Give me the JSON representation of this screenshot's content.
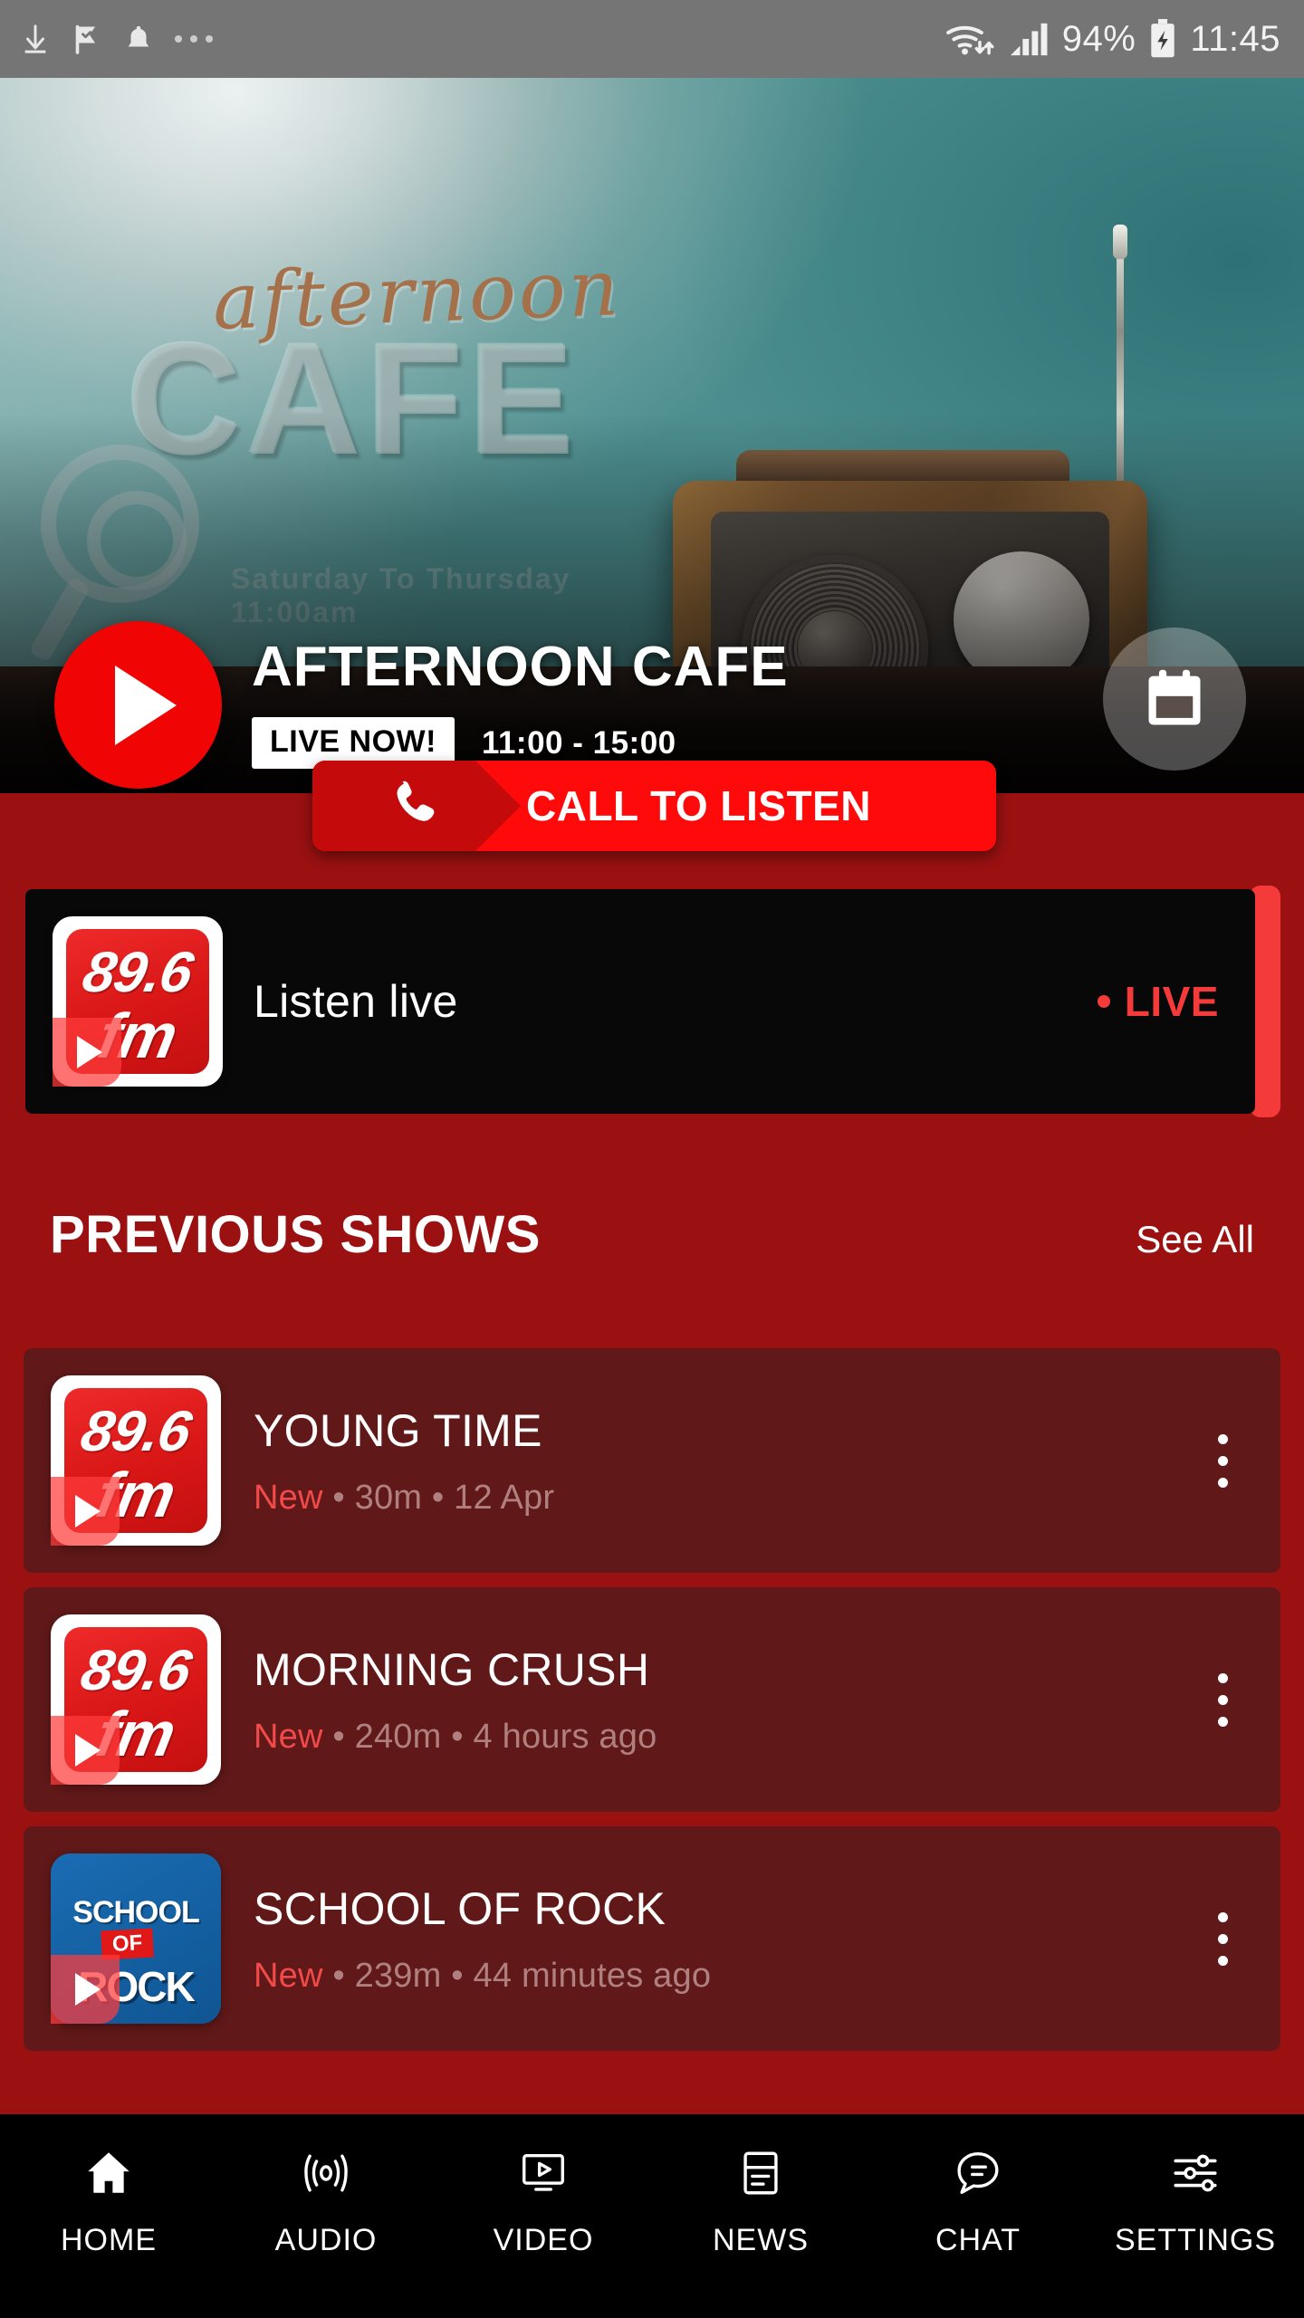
{
  "status_bar": {
    "icons_left": [
      "download-icon",
      "flag-check-icon",
      "bell-icon",
      "more-icon"
    ],
    "wifi": "wifi-icon",
    "signal": "signal-icon",
    "battery_percent": "94%",
    "battery": "battery-charging-icon",
    "time": "11:45"
  },
  "hero": {
    "artwork": {
      "word_script": "afternoon",
      "word_block": "CAFE",
      "subline": "Saturday To Thursday 11:00am"
    },
    "play_button": "play-icon",
    "title": "AFTERNOON CAFE",
    "live_badge": "LIVE NOW!",
    "time_range": "11:00 - 15:00",
    "calendar_button": "calendar-icon"
  },
  "call_button": {
    "icon": "phone-icon",
    "label": "CALL TO LISTEN"
  },
  "listen_card": {
    "logo": {
      "number": "89.6",
      "unit": "fm",
      "badge": "play-icon"
    },
    "label": "Listen live",
    "status": "LIVE",
    "status_dot": "live-dot"
  },
  "section": {
    "title": "PREVIOUS SHOWS",
    "see_all": "See All"
  },
  "shows": [
    {
      "title": "YOUNG TIME",
      "badge": "New",
      "meta": " • 30m • 12 Apr",
      "artwork_type": "fm-logo",
      "artwork": {
        "number": "89.6",
        "unit": "fm"
      },
      "menu": "kebab-menu-icon"
    },
    {
      "title": "MORNING CRUSH",
      "badge": "New",
      "meta": " • 240m • 4 hours ago",
      "artwork_type": "fm-logo",
      "artwork": {
        "number": "89.6",
        "unit": "fm"
      },
      "menu": "kebab-menu-icon"
    },
    {
      "title": "SCHOOL OF ROCK",
      "badge": "New",
      "meta": " • 239m • 44 minutes ago",
      "artwork_type": "school-of-rock",
      "artwork": {
        "line1": "SCHOOL",
        "line2": "OF",
        "line3": "ROCK"
      },
      "menu": "kebab-menu-icon"
    }
  ],
  "bottom_nav": {
    "active": "HOME",
    "items": [
      {
        "label": "HOME",
        "icon": "home-icon"
      },
      {
        "label": "AUDIO",
        "icon": "broadcast-icon"
      },
      {
        "label": "VIDEO",
        "icon": "video-monitor-icon"
      },
      {
        "label": "NEWS",
        "icon": "article-icon"
      },
      {
        "label": "CHAT",
        "icon": "speech-bubble-icon"
      },
      {
        "label": "SETTINGS",
        "icon": "sliders-icon"
      }
    ]
  },
  "colors": {
    "background": "#9B1111",
    "card_background": "#601818",
    "accent_red": "#F53A3A",
    "button_red": "#FF0A0A",
    "black": "#080808"
  }
}
